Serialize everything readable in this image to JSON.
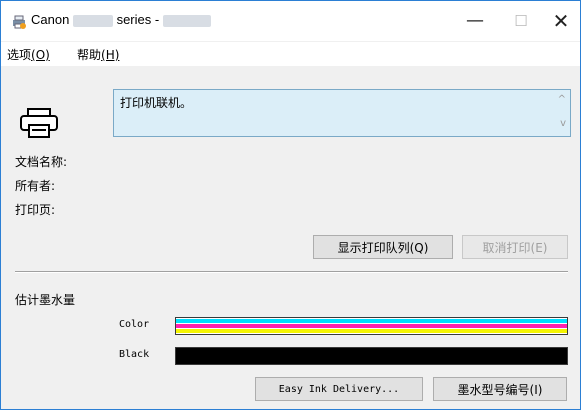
{
  "window": {
    "title_prefix": "Canon",
    "title_series": "series -",
    "min_symbol": "—",
    "max_symbol": "☐",
    "close_symbol": "✕"
  },
  "menu": [
    {
      "label": "选项",
      "accel": "(O)"
    },
    {
      "label": "帮助",
      "accel": "(H)"
    }
  ],
  "status": {
    "message": "打印机联机。"
  },
  "fields": {
    "doc_name": "文档名称:",
    "owner": "所有者:",
    "printing_page": "打印页:"
  },
  "buttons": {
    "show_queue": "显示打印队列(Q)",
    "cancel_print": "取消打印(E)",
    "easy_ink": "Easy Ink Delivery...",
    "ink_model": "墨水型号编号(I)"
  },
  "ink": {
    "section_title": "估计墨水量",
    "color_label": "Color",
    "black_label": "Black",
    "color_level": 1.0,
    "black_level": 1.0,
    "colors": {
      "cyan": "#00e0ff",
      "magenta": "#ff1fb0",
      "yellow": "#f4f400",
      "black": "#000000"
    }
  },
  "icons": [
    "printer-app-icon",
    "printer-icon"
  ]
}
